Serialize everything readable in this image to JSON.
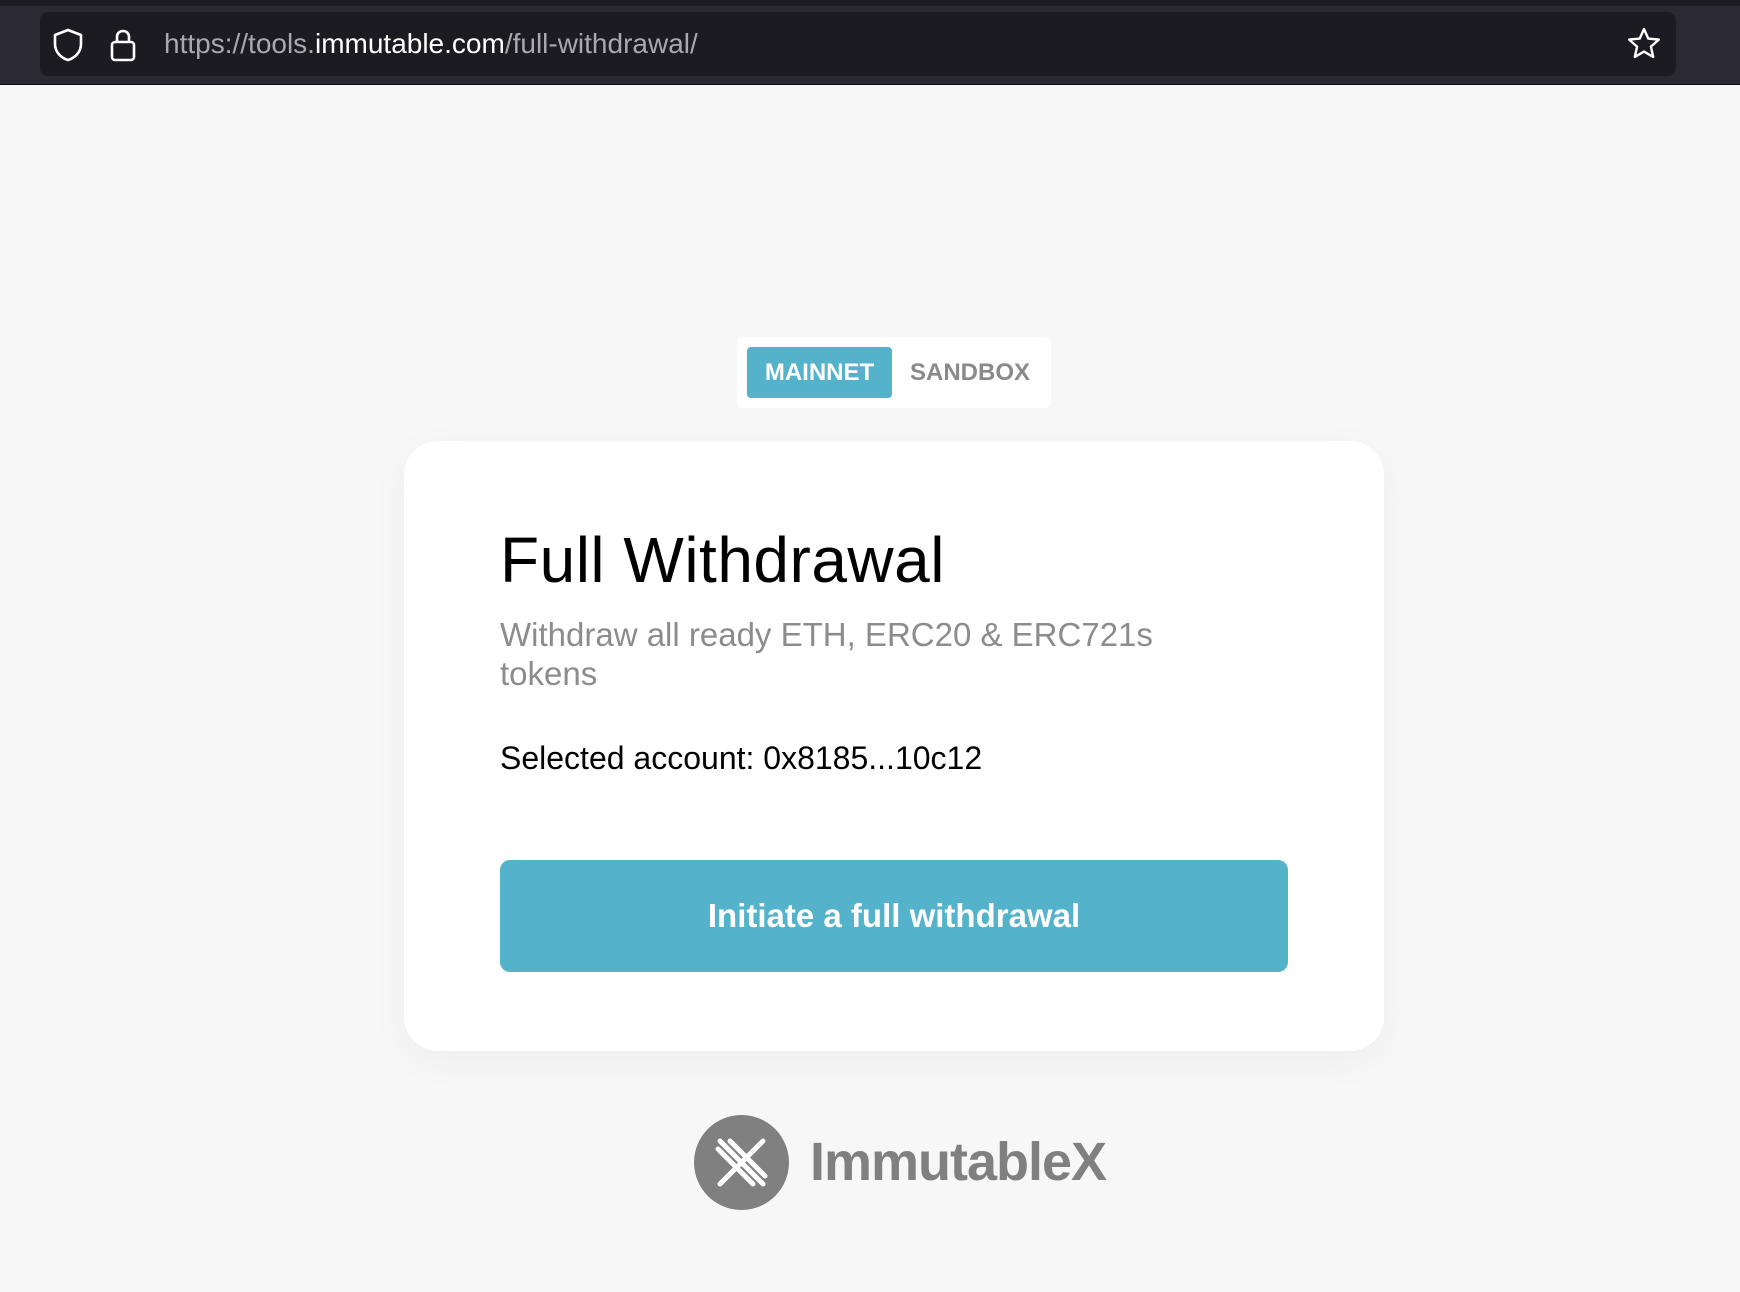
{
  "browser": {
    "url_prefix": "https://tools.",
    "url_domain": "immutable.com",
    "url_path": "/full-withdrawal/"
  },
  "network_toggle": {
    "options": [
      "MAINNET",
      "SANDBOX"
    ],
    "selected": "MAINNET"
  },
  "card": {
    "title": "Full Withdrawal",
    "subtitle": "Withdraw all ready ETH, ERC20 & ERC721s tokens",
    "account_text": "Selected account: 0x8185...10c12",
    "button_label": "Initiate a full withdrawal"
  },
  "brand": {
    "name": "ImmutableX"
  },
  "colors": {
    "accent": "#55b2cb",
    "page_background": "#f7f7f7",
    "brand_gray": "#808080",
    "subtitle_gray": "#8c8c8c"
  },
  "icons": {
    "url_bar": [
      "shield-icon",
      "lock-icon"
    ],
    "bookmark": "star-icon",
    "brand": "immutablex-logo-icon"
  }
}
